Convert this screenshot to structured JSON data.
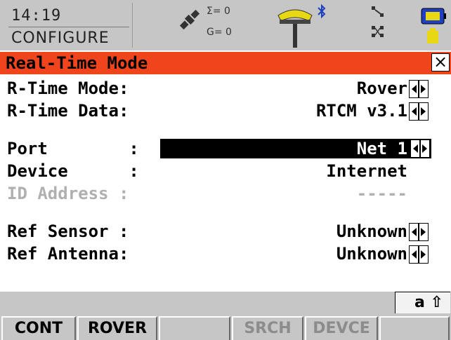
{
  "status_bar": {
    "time": "14:19",
    "screen": "CONFIGURE",
    "sat_sigma": "Σ= 0",
    "sat_g": "G= 0",
    "icons": [
      "satellite-icon",
      "antenna-icon",
      "bluetooth-icon",
      "link-icon",
      "network-icon",
      "battery-icon"
    ]
  },
  "title": "Real-Time Mode",
  "fields": [
    {
      "label": "R-Time Mode:",
      "value": "Rover"
    },
    {
      "label": "R-Time Data:",
      "value": "RTCM v3.1"
    },
    {
      "label": "Port        :",
      "value": "Net 1"
    },
    {
      "label": "Device      :",
      "value": "Internet"
    },
    {
      "label": "ID Address :",
      "value": "-----"
    },
    {
      "label": "Ref Sensor :",
      "value": "Unknown"
    },
    {
      "label": "Ref Antenna:",
      "value": "Unknown"
    }
  ],
  "input_mode": "a ⇧",
  "fkeys": [
    {
      "label": "CONT"
    },
    {
      "label": "ROVER"
    },
    {
      "label": ""
    },
    {
      "label": "SRCH"
    },
    {
      "label": "DEVCE"
    },
    {
      "label": ""
    }
  ],
  "colors": {
    "title_bar": "#f0451c",
    "status_bg": "#c6c6c6",
    "disabled_text": "#b0b0b0",
    "highlight_field": "#000000"
  }
}
